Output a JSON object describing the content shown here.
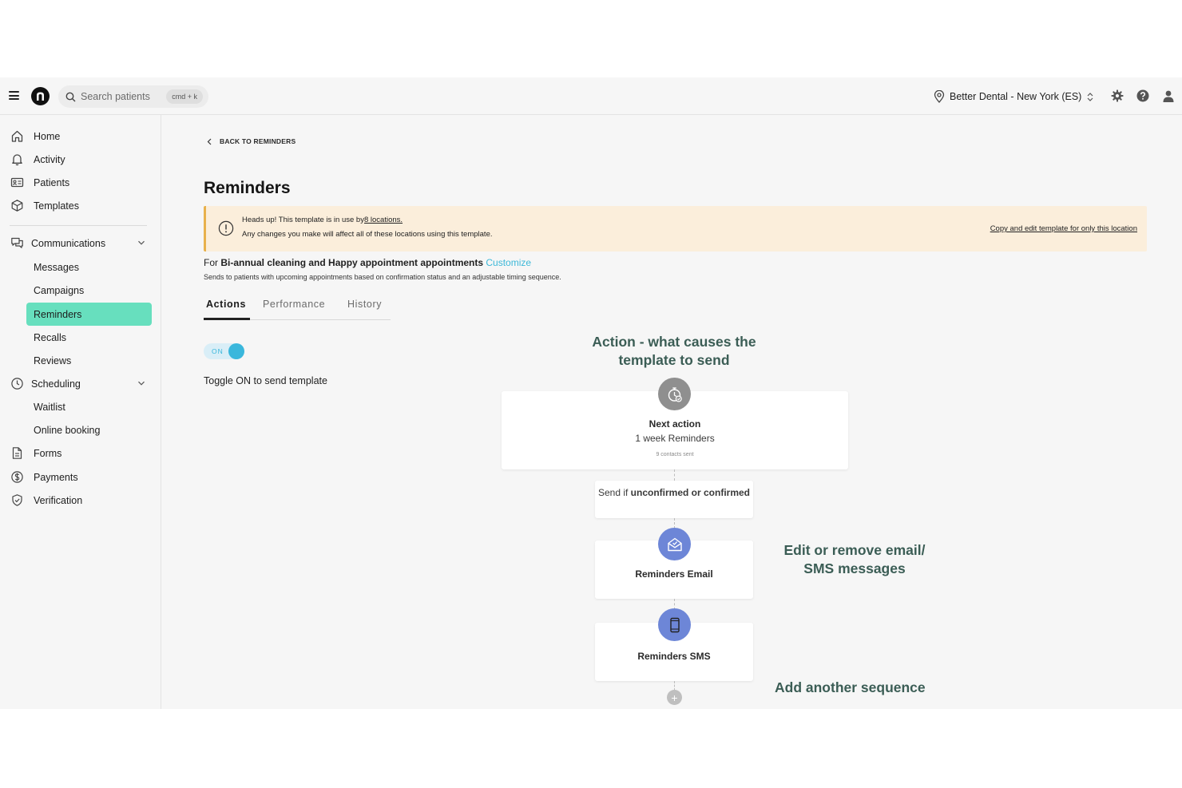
{
  "topbar": {
    "search_placeholder": "Search patients",
    "shortcut": "cmd + k",
    "location": "Better Dental - New York (ES)"
  },
  "sidebar": {
    "home": "Home",
    "activity": "Activity",
    "patients": "Patients",
    "templates": "Templates",
    "communications": "Communications",
    "messages": "Messages",
    "campaigns": "Campaigns",
    "reminders": "Reminders",
    "recalls": "Recalls",
    "reviews": "Reviews",
    "scheduling": "Scheduling",
    "waitlist": "Waitlist",
    "online_booking": "Online booking",
    "forms": "Forms",
    "payments": "Payments",
    "verification": "Verification"
  },
  "main": {
    "back_label": "BACK TO REMINDERS",
    "title": "Reminders",
    "banner": {
      "line1_prefix": "Heads up! This template is in use by",
      "line1_link": "8 locations.",
      "line2": "Any changes you make will affect all of these locations using this template.",
      "copy_link": "Copy and edit template for only this location"
    },
    "for_prefix": "For",
    "for_bold": "Bi-annual cleaning and Happy appointment appointments",
    "customize": "Customize",
    "description": "Sends to patients with upcoming appointments based on confirmation status and an adjustable timing sequence.",
    "tabs": [
      "Actions",
      "Performance",
      "History"
    ],
    "toggle_label": "ON",
    "toggle_hint": "Toggle ON to send template"
  },
  "flow": {
    "annotation_action": "Action - what causes the template to send",
    "annotation_edit": "Edit or remove email/ SMS messages",
    "annotation_add": "Add another sequence",
    "next_action_title": "Next action",
    "next_action_sub": "1 week Reminders",
    "next_action_count": "9 contacts sent",
    "condition_prefix": "Send if",
    "condition_bold": "unconfirmed or confirmed",
    "email_title": "Reminders Email",
    "sms_title": "Reminders SMS",
    "add_symbol": "+"
  },
  "colors": {
    "accent_active": "#67dfbe",
    "toggle_blue": "#3ab7dc",
    "banner_bg": "#fbeedb",
    "annotation": "#3b5d55",
    "step_icon_blue": "#6d86d7"
  },
  "icons": [
    "menu-icon",
    "logo-icon",
    "search-icon",
    "location-pin-icon",
    "sort-arrows-icon",
    "gear-icon",
    "help-icon",
    "user-icon",
    "home-icon",
    "bell-icon",
    "id-card-icon",
    "cube-icon",
    "chat-icon",
    "clock-icon",
    "document-icon",
    "dollar-icon",
    "shield-icon",
    "chevron-left-icon",
    "chevron-down-icon",
    "warning-icon",
    "timer-icon",
    "mail-icon",
    "phone-icon",
    "plus-icon"
  ]
}
